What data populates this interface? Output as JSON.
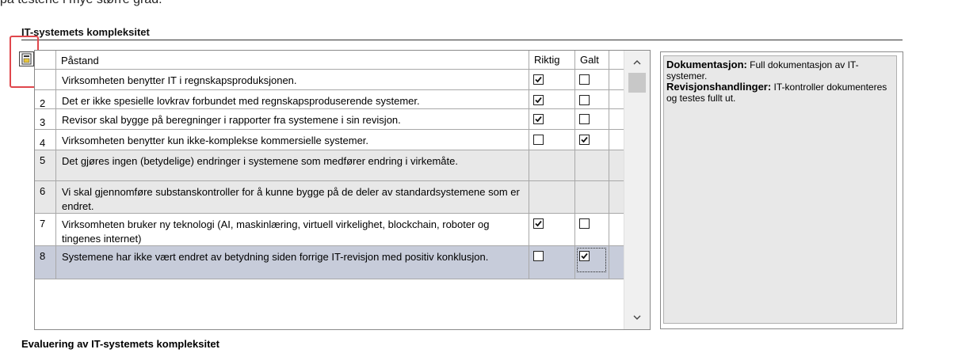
{
  "top_fragment": "på testene i mye større grad.",
  "section": {
    "title": "IT-systemets kompleksitet"
  },
  "table": {
    "headers": {
      "num": "",
      "statement": "Påstand",
      "correct": "Riktig",
      "false": "Galt"
    },
    "rows": [
      {
        "num": "",
        "text": "Virksomheten benytter IT i regnskapsproduksjonen.",
        "correct": true,
        "false": false,
        "style": "normal"
      },
      {
        "num": "2",
        "text": "Det er ikke spesielle lovkrav forbundet med regnskapsproduserende systemer.",
        "correct": true,
        "false": false,
        "style": "normal"
      },
      {
        "num": "3",
        "text": "Revisor skal bygge på beregninger i rapporter fra systemene i sin revisjon.",
        "correct": true,
        "false": false,
        "style": "normal"
      },
      {
        "num": "4",
        "text": "Virksomheten benytter kun ikke-komplekse kommersielle systemer.",
        "correct": false,
        "false": true,
        "style": "normal"
      },
      {
        "num": "5",
        "text": "Det gjøres ingen (betydelige) endringer i systemene som medfører endring i virkemåte.",
        "correct": null,
        "false": null,
        "style": "gray"
      },
      {
        "num": "6",
        "text": "Vi skal gjennomføre substanskontroller for å kunne bygge på de deler av standardsystemene som er endret.",
        "correct": null,
        "false": null,
        "style": "gray"
      },
      {
        "num": "7",
        "text": "Virksomheten bruker ny teknologi (AI, maskinlæring, virtuell virkelighet, blockchain, roboter og tingenes internet)",
        "correct": true,
        "false": false,
        "style": "normal"
      },
      {
        "num": "8",
        "text": "Systemene har ikke vært endret av betydning siden forrige IT-revisjon med positiv konklusjon.",
        "correct": false,
        "false": true,
        "style": "selected"
      }
    ]
  },
  "info_panel": {
    "doc_label": "Dokumentasjon:",
    "doc_text": " Full dokumentasjon av IT-systemer.",
    "actions_label": "Revisjonshandlinger:",
    "actions_text": " IT-kontroller dokumenteres og testes fullt ut."
  },
  "bottom": {
    "title": "Evaluering av IT-systemets kompleksitet"
  },
  "colors": {
    "highlight": "#e0474c",
    "selected_row": "#c7ccda",
    "disabled_row": "#e8e8e8"
  },
  "icons": {
    "row_tool": "document-grid-icon",
    "scroll_up": "chevron-up-icon",
    "scroll_down": "chevron-down-icon"
  }
}
